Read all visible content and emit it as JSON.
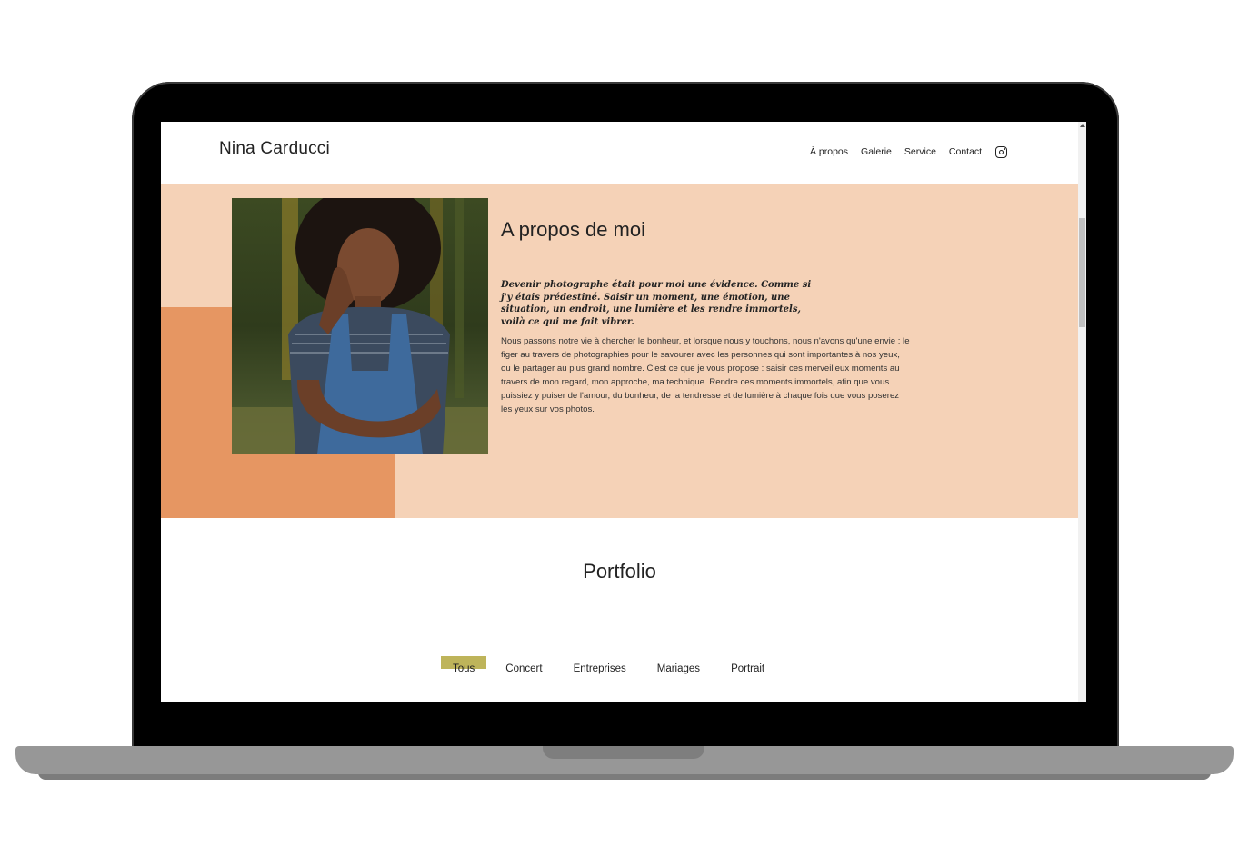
{
  "site": {
    "title": "Nina Carducci"
  },
  "nav": {
    "items": [
      {
        "label": "À propos"
      },
      {
        "label": "Galerie"
      },
      {
        "label": "Service"
      },
      {
        "label": "Contact"
      }
    ],
    "icon": "instagram-icon"
  },
  "about": {
    "heading": "A propos de moi",
    "quote": "Devenir photographe était pour moi une évidence. Comme si j'y étais prédestiné. Saisir un moment, une émotion, une situation, un endroit, une lumière et les rendre immortels, voilà ce qui me fait vibrer.",
    "body": "Nous passons notre vie à chercher le bonheur, et lorsque nous y touchons, nous n'avons qu'une envie : le figer au travers de photographies pour le savourer avec les personnes qui sont importantes à nos yeux, ou le partager au plus grand nombre. C'est ce que je vous propose : saisir ces merveilleux moments au travers de mon regard, mon approche, ma technique. Rendre ces moments immortels, afin que vous puissiez y puiser de l'amour, du bonheur, de la tendresse et de lumière à chaque fois que vous poserez les yeux sur vos photos."
  },
  "portfolio": {
    "heading": "Portfolio",
    "filters": [
      {
        "label": "Tous",
        "active": true
      },
      {
        "label": "Concert",
        "active": false
      },
      {
        "label": "Entreprises",
        "active": false
      },
      {
        "label": "Mariages",
        "active": false
      },
      {
        "label": "Portrait",
        "active": false
      }
    ]
  },
  "colors": {
    "about_bg": "#f5d2b7",
    "about_accent": "#e69662",
    "filter_active": "#beb45a"
  }
}
